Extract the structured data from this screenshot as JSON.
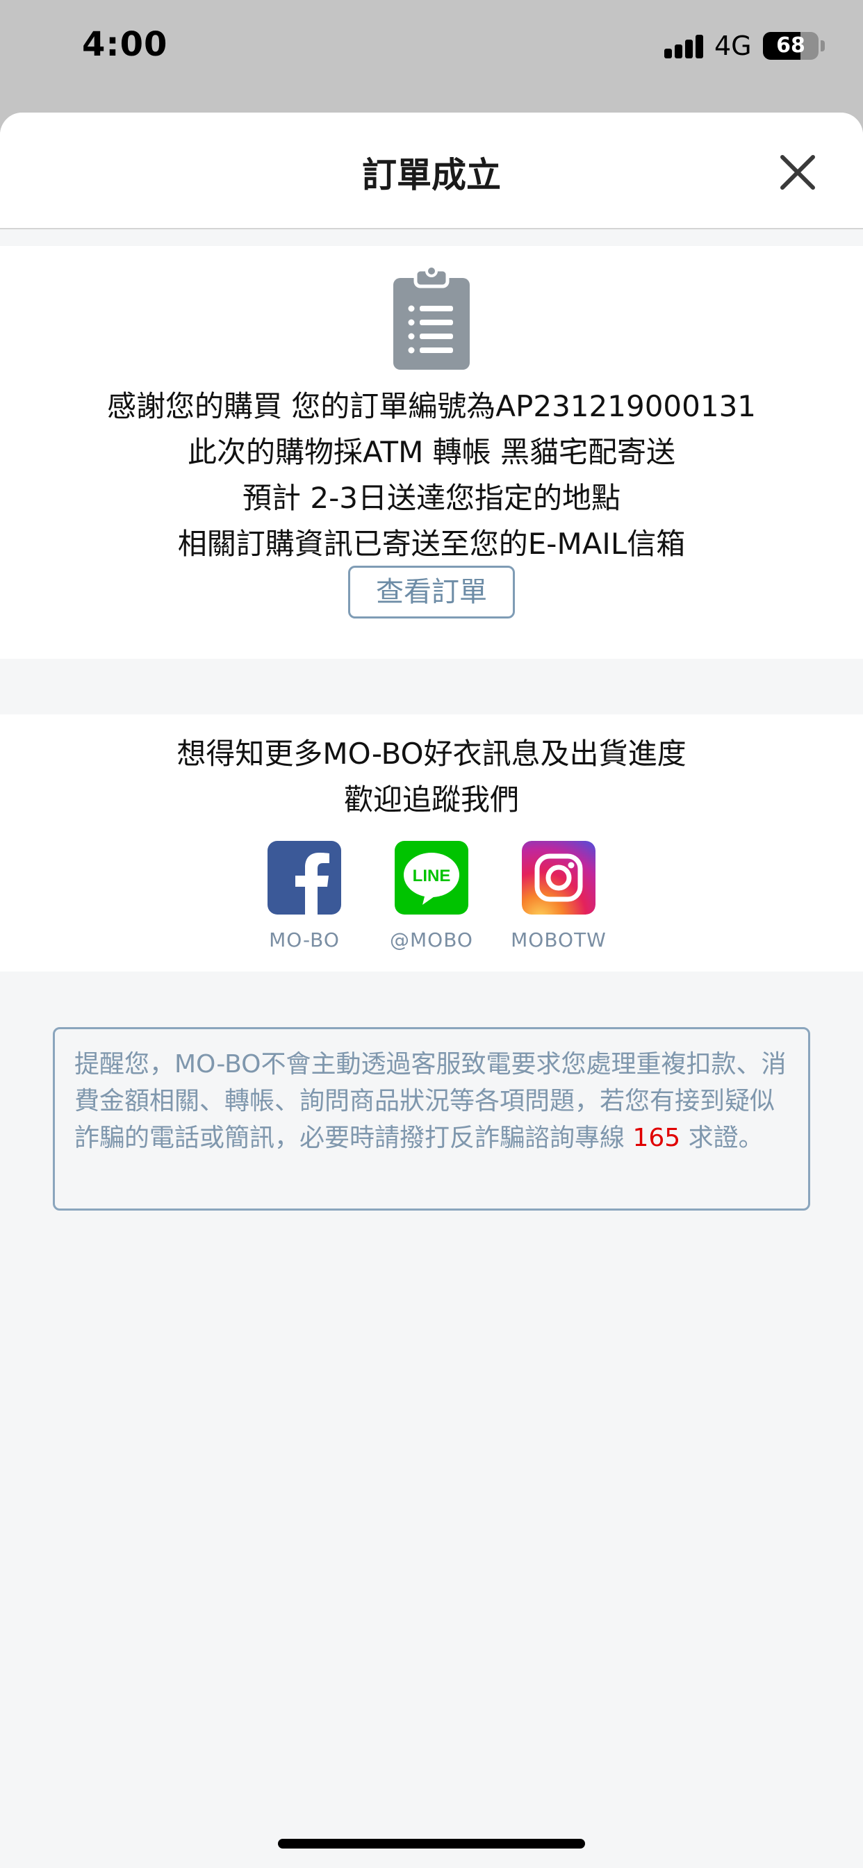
{
  "status_bar": {
    "time": "4:00",
    "network": "4G",
    "battery": "68",
    "battery_level": 0.68
  },
  "header": {
    "title": "訂單成立",
    "close_icon": "close-icon"
  },
  "order": {
    "icon": "clipboard-list-icon",
    "lines": [
      "感謝您的購買 您的訂單編號為AP231219000131",
      "此次的購物採ATM 轉帳 黑貓宅配寄送",
      "預計 2-3日送達您指定的地點",
      "相關訂購資訊已寄送至您的E-MAIL信箱"
    ],
    "view_order_label": "查看訂單"
  },
  "follow": {
    "lines": [
      "想得知更多MO-BO好衣訊息及出貨進度",
      "歡迎追蹤我們"
    ],
    "socials": [
      {
        "icon": "facebook-icon",
        "label": "MO-BO"
      },
      {
        "icon": "line-icon",
        "label": "@MOBO",
        "icon_text": "LINE"
      },
      {
        "icon": "instagram-icon",
        "label": "MOBOTW"
      }
    ]
  },
  "notice": {
    "text_before": "提醒您，MO-BO不會主動透過客服致電要求您處理重複扣款、消費金額相關、轉帳、詢問商品狀況等各項問題，若您有接到疑似詐騙的電話或簡訊，必要時請撥打反詐騙諮詢專線",
    "hotline": "165",
    "text_after": "求證。"
  },
  "colors": {
    "facebook": "#3b5998",
    "line": "#00c300",
    "hotline": "#e00000",
    "accent": "#7f9cb5"
  }
}
